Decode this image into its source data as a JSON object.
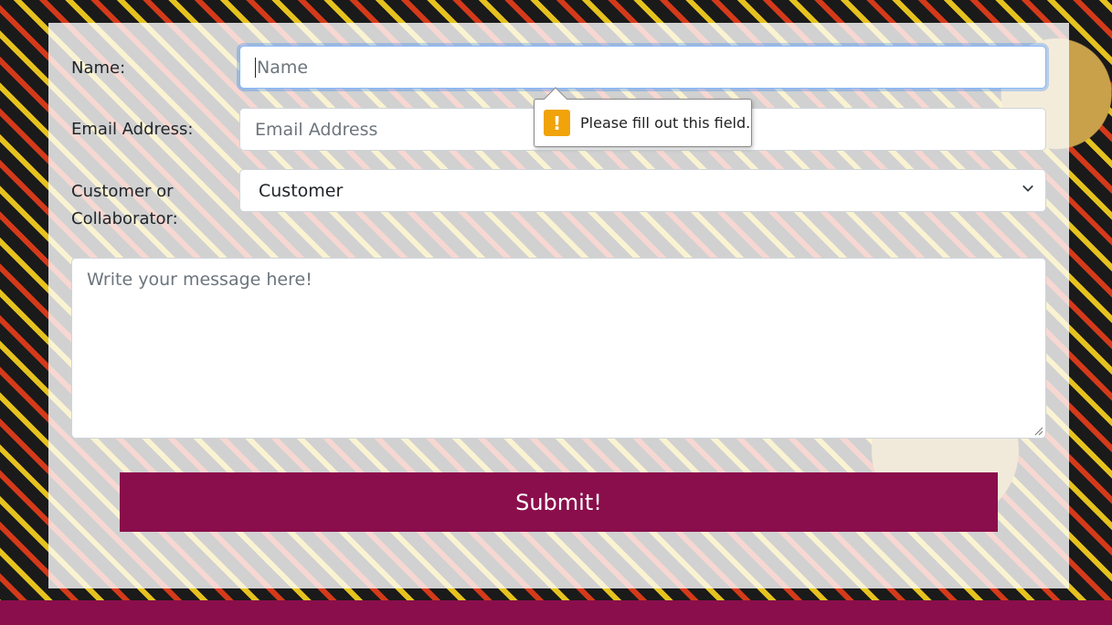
{
  "form": {
    "name_label": "Name:",
    "name_placeholder": "Name",
    "email_label": "Email Address:",
    "email_placeholder": "Email Address",
    "role_label_line1": "Customer or",
    "role_label_line2": "Collaborator:",
    "role_selected": "Customer",
    "message_placeholder": "Write your message here!",
    "submit_label": "Submit!"
  },
  "validation_tooltip": {
    "icon": "warning-icon",
    "icon_glyph": "!",
    "message": "Please fill out this field."
  },
  "colors": {
    "brand": "#8a0e4c",
    "warning": "#f0a30a",
    "focus_border": "#86b7fe"
  }
}
